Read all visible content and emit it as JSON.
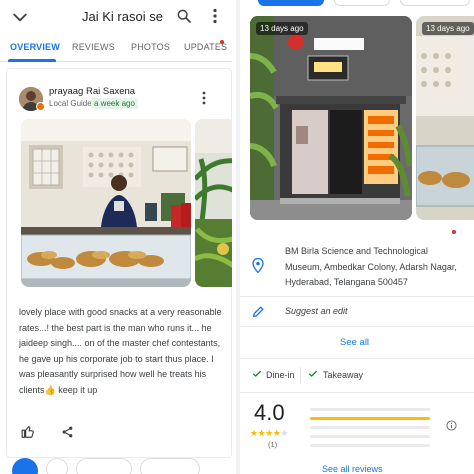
{
  "header": {
    "title": "Jai Ki rasoi se"
  },
  "tabs": [
    {
      "label": "OVERVIEW"
    },
    {
      "label": "REVIEWS"
    },
    {
      "label": "PHOTOS"
    },
    {
      "label": "UPDATES"
    }
  ],
  "review": {
    "author": "prayaag Rai Saxena",
    "badge": "Local Guide",
    "time": "a week ago",
    "text": "lovely place with good snacks at a very reasonable rates...! the best part is the man who runs it... he jaideep singh.... on of the master chef contestants, he gave up his corporate job to start thus place. I was pleasantly surprised how well he treats his clients👍 keep it up"
  },
  "gallery": {
    "photo1_age": "13 days ago",
    "photo2_age": "13 days ago"
  },
  "details": {
    "address": "BM Birla Science and Technological Museum, Ambedkar Colony, Adarsh Nagar, Hyderabad, Telangana 500457",
    "suggest_edit": "Suggest an edit",
    "see_all": "See all",
    "service1": "Dine-in",
    "service2": "Takeaway"
  },
  "rating": {
    "value": "4.0",
    "count": "(1)",
    "stars": 4,
    "distribution": [
      {
        "stars": 5,
        "fraction": 0.0
      },
      {
        "stars": 4,
        "fraction": 1.0
      },
      {
        "stars": 3,
        "fraction": 0.0
      },
      {
        "stars": 2,
        "fraction": 0.0
      },
      {
        "stars": 1,
        "fraction": 0.0
      }
    ],
    "see_reviews": "See all reviews"
  },
  "colors": {
    "accent": "#1a73e8",
    "star": "#fbbc04",
    "green": "#188038",
    "red_dot": "#d93025"
  },
  "icons": [
    "back-arrow-icon",
    "search-icon",
    "more-vert-icon",
    "like-icon",
    "share-icon",
    "location-pin-icon",
    "edit-pencil-icon",
    "check-icon",
    "info-icon"
  ]
}
